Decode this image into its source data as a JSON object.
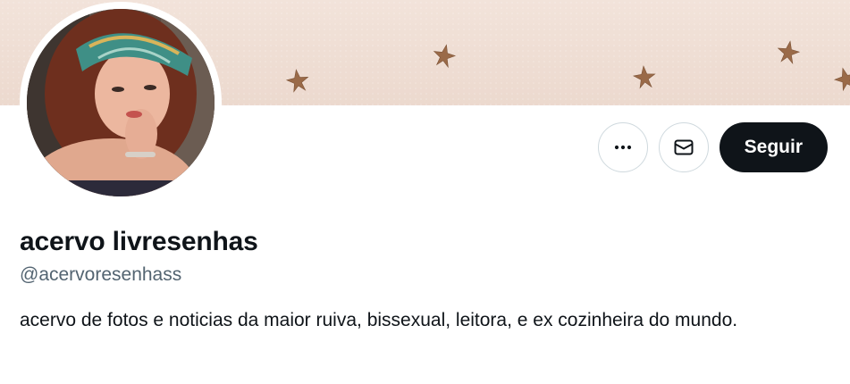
{
  "profile": {
    "display_name": "acervo livresenhas",
    "handle": "@acervoresenhass",
    "bio": "acervo de fotos e noticias da maior ruiva, bissexual, leitora, e ex cozinheira do mundo."
  },
  "actions": {
    "more_icon": "more-horizontal-icon",
    "message_icon": "envelope-icon",
    "follow_label": "Seguir"
  },
  "colors": {
    "follow_button_bg": "#0f1419",
    "banner_bg": "#efdfd5",
    "star_color": "#9a6a48",
    "handle_color": "#536471",
    "border_color": "#cfd9de"
  }
}
